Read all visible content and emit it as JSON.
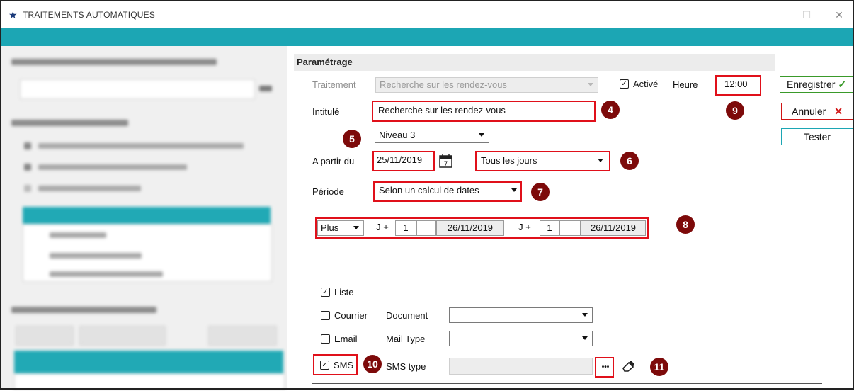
{
  "window": {
    "title": "TRAITEMENTS AUTOMATIQUES",
    "minimize": "—",
    "maximize": "☐",
    "close": "✕"
  },
  "section": {
    "title": "Paramétrage"
  },
  "form": {
    "traitement_label": "Traitement",
    "traitement_value": "Recherche sur les rendez-vous",
    "active_label": "Activé",
    "active_checked": true,
    "heure_label": "Heure",
    "heure_value": "12:00",
    "intitule_label": "Intitulé",
    "intitule_value": "Recherche sur les rendez-vous",
    "niveau_value": "Niveau 3",
    "apartir_label": "A partir du",
    "date_value": "25/11/2019",
    "frequence_value": "Tous les jours",
    "periode_label": "Période",
    "periode_value": "Selon un calcul de dates"
  },
  "period_calc": {
    "mode": "Plus",
    "j1": "J +",
    "n1": "1",
    "eq1": "=",
    "d1": "26/11/2019",
    "j2": "J +",
    "n2": "1",
    "eq2": "=",
    "d2": "26/11/2019"
  },
  "outputs": {
    "liste_label": "Liste",
    "liste_checked": true,
    "courrier_label": "Courrier",
    "courrier_checked": false,
    "document_label": "Document",
    "email_label": "Email",
    "email_checked": false,
    "mailtype_label": "Mail Type",
    "sms_label": "SMS",
    "sms_checked": true,
    "smstype_label": "SMS type",
    "ellipsis": "•••"
  },
  "buttons": {
    "save": "Enregistrer",
    "cancel": "Annuler",
    "test": "Tester"
  },
  "badges": [
    "4",
    "5",
    "6",
    "7",
    "8",
    "9",
    "10",
    "11"
  ],
  "colors": {
    "teal": "#1ca6b4",
    "annotation_red": "#e0101a",
    "badge": "#7d0a0a",
    "save_green": "#3a9a2a",
    "cancel_red": "#d01515"
  }
}
